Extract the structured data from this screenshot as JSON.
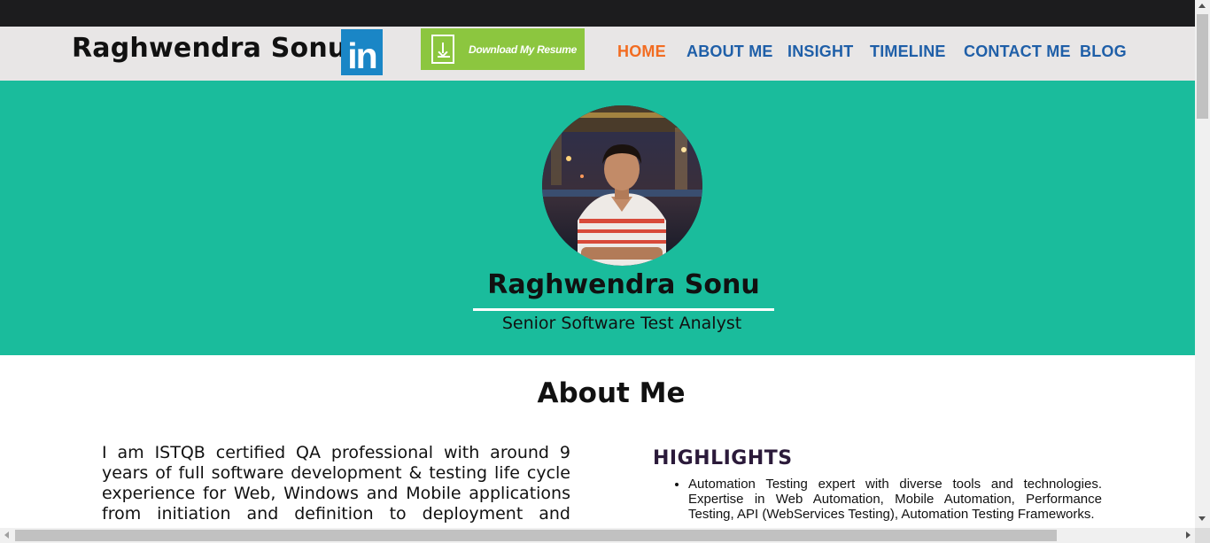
{
  "header": {
    "brand": "Raghwendra Sonu",
    "linkedin_text": "in",
    "resume_button": "Download My Resume",
    "nav": [
      {
        "label": "HOME",
        "active": true
      },
      {
        "label": "ABOUT ME",
        "active": false
      },
      {
        "label": "INSIGHT",
        "active": false
      },
      {
        "label": "TIMELINE",
        "active": false
      },
      {
        "label": "CONTACT ME",
        "active": false
      },
      {
        "label": "BLOG",
        "active": false
      }
    ]
  },
  "hero": {
    "name": "Raghwendra Sonu",
    "role": "Senior Software Test Analyst"
  },
  "about": {
    "title": "About Me",
    "text": "I am ISTQB certified QA professional with around 9 years of full software development & testing life cycle experience for Web, Windows and Mobile applications from initiation and definition to deployment and",
    "highlights_title": "HIGHLIGHTS",
    "highlights": [
      "Automation Testing expert with diverse tools and technologies. Expertise in Web Automation, Mobile Automation, Performance Testing, API (WebServices Testing), Automation Testing Frameworks."
    ]
  },
  "colors": {
    "hero_bg": "#1abc9c",
    "nav_color": "#1f5fa8",
    "nav_active": "#f26c21",
    "resume_green": "#8cc63f",
    "linkedin_blue": "#1a86c6"
  },
  "icons": [
    "linkedin-icon",
    "download-document-icon"
  ]
}
